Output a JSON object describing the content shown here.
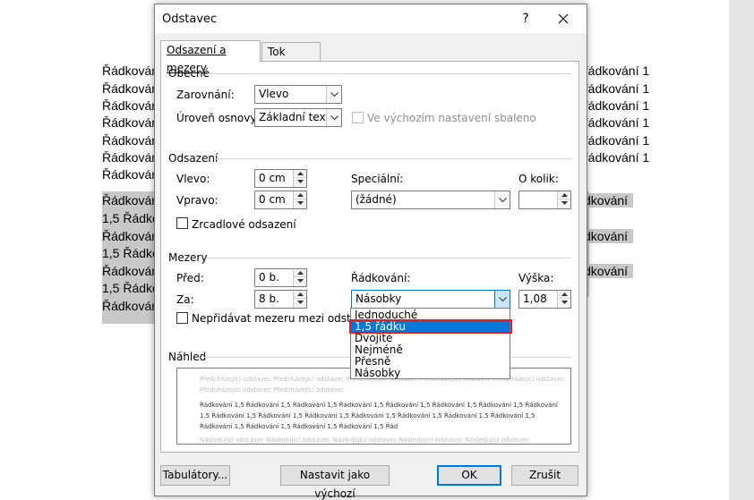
{
  "document": {
    "left_lines": [
      "Řádkování",
      "Řádkování",
      "Řádkování",
      "Řádkování",
      "Řádkování",
      "Řádkování",
      "Řádkování"
    ],
    "right_lines": [
      "řádkování 1",
      "řádkování 1",
      "řádkování 1",
      "řádkování 1",
      "řádkování 1",
      "řádkování 1"
    ],
    "highlighted_left": [
      "Řádkování",
      "1,5 Řádkov",
      "Řádkování",
      "1,5 Řádkov",
      "Řádkování",
      "1,5 Řádkov",
      "Řádkování"
    ],
    "highlighted_right": [
      "dkování",
      "dkování",
      "dkování"
    ]
  },
  "dialog": {
    "title": "Odstavec",
    "help_label": "?",
    "tabs": [
      {
        "label": "Odsazení a mezery",
        "active": true
      },
      {
        "label": "Tok textu",
        "active": false
      }
    ],
    "general": {
      "section_title": "Obecné",
      "alignment_label": "Zarovnání:",
      "alignment_value": "Vlevo",
      "outline_label": "Úroveň osnovy:",
      "outline_value": "Základní text",
      "collapsed_label": "Ve výchozím nastavení sbaleno",
      "collapsed_checked": false
    },
    "indent": {
      "section_title": "Odsazení",
      "left_label": "Vlevo:",
      "left_value": "0 cm",
      "right_label": "Vpravo:",
      "right_value": "0 cm",
      "special_label": "Speciální:",
      "special_value": "(žádné)",
      "by_label": "O kolik:",
      "by_value": "",
      "mirror_label": "Zrcadlové odsazení",
      "mirror_checked": false
    },
    "spacing": {
      "section_title": "Mezery",
      "before_label": "Před:",
      "before_value": "0 b.",
      "after_label": "Za:",
      "after_value": "8 b.",
      "line_spacing_label": "Řádkování:",
      "line_spacing_value": "Násobky",
      "at_label": "Výška:",
      "at_value": "1,08",
      "dont_add_label": "Nepřidávat mezeru mezi odstavce s",
      "dont_add_checked": false
    },
    "line_spacing_options": [
      "Jednoduché",
      "1,5 řádku",
      "Dvojité",
      "Nejméně",
      "Přesně",
      "Násobky"
    ],
    "line_spacing_selected_index": 1,
    "preview": {
      "section_title": "Náhled",
      "prev_lines": [
        "Předcházející odstavec Předcházející odstavec Předcházející odstavec Předcházející odstavec Předcházející odstavec",
        "Předcházející odstavec Předcházející odstavec"
      ],
      "sample_lines": [
        "Řádkování 1,5 Řádkování 1,5 Řádkování 1,5 Řádkování 1,5 Řádkování 1,5 Řádkování 1,5 Řádkování 1,5 Řádkování",
        "1,5 Řádkování 1,5 Řádkování 1,5 Řádkování 1,5 Řádkování 1,5 Řádkování 1,5 Řádkování 1,5 Řádkování 1,5",
        "Řádkování 1,5 Řádkování 1,5 Řádkování 1,5 Řádkování 1,5 Řád"
      ],
      "next_lines": [
        "Následující odstavec Následující odstavec Následující odstavec Následující odstavec Následující odstavec"
      ]
    },
    "buttons": {
      "tabs_label": "Tabulátory...",
      "default_label": "Nastavit jako výchozí",
      "ok_label": "OK",
      "cancel_label": "Zrušit"
    }
  },
  "colors": {
    "accent": "#0078d7",
    "highlight_frame": "#e02020",
    "doc_selection": "#c8c8c8"
  }
}
